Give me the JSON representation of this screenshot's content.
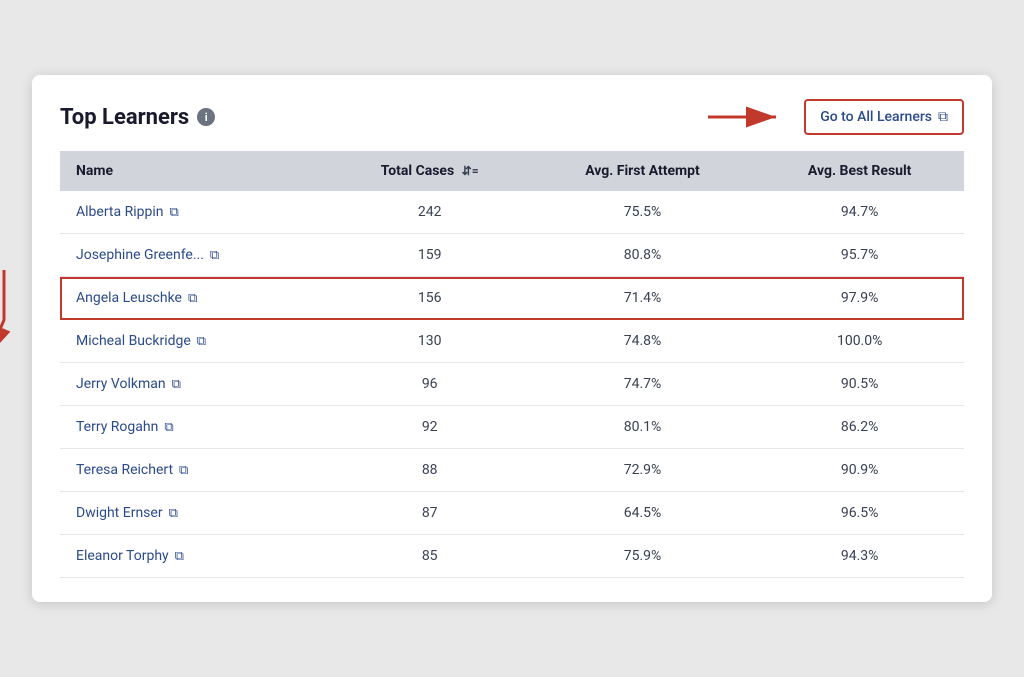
{
  "card": {
    "title": "Top Learners",
    "go_to_label": "Go to All Learners",
    "columns": [
      {
        "key": "name",
        "label": "Name",
        "sortable": false
      },
      {
        "key": "total_cases",
        "label": "Total Cases",
        "sortable": true
      },
      {
        "key": "avg_first_attempt",
        "label": "Avg. First Attempt",
        "sortable": false
      },
      {
        "key": "avg_best_result",
        "label": "Avg. Best Result",
        "sortable": false
      }
    ],
    "rows": [
      {
        "name": "Alberta Rippin",
        "total_cases": "242",
        "avg_first_attempt": "75.5%",
        "avg_best_result": "94.7%",
        "highlighted": false
      },
      {
        "name": "Josephine Greenfe...",
        "total_cases": "159",
        "avg_first_attempt": "80.8%",
        "avg_best_result": "95.7%",
        "highlighted": false
      },
      {
        "name": "Angela Leuschke",
        "total_cases": "156",
        "avg_first_attempt": "71.4%",
        "avg_best_result": "97.9%",
        "highlighted": true
      },
      {
        "name": "Micheal Buckridge",
        "total_cases": "130",
        "avg_first_attempt": "74.8%",
        "avg_best_result": "100.0%",
        "highlighted": false
      },
      {
        "name": "Jerry Volkman",
        "total_cases": "96",
        "avg_first_attempt": "74.7%",
        "avg_best_result": "90.5%",
        "highlighted": false
      },
      {
        "name": "Terry Rogahn",
        "total_cases": "92",
        "avg_first_attempt": "80.1%",
        "avg_best_result": "86.2%",
        "highlighted": false
      },
      {
        "name": "Teresa Reichert",
        "total_cases": "88",
        "avg_first_attempt": "72.9%",
        "avg_best_result": "90.9%",
        "highlighted": false
      },
      {
        "name": "Dwight Ernser",
        "total_cases": "87",
        "avg_first_attempt": "64.5%",
        "avg_best_result": "96.5%",
        "highlighted": false
      },
      {
        "name": "Eleanor Torphy",
        "total_cases": "85",
        "avg_first_attempt": "75.9%",
        "avg_best_result": "94.3%",
        "highlighted": false
      }
    ],
    "info_icon_label": "i"
  }
}
